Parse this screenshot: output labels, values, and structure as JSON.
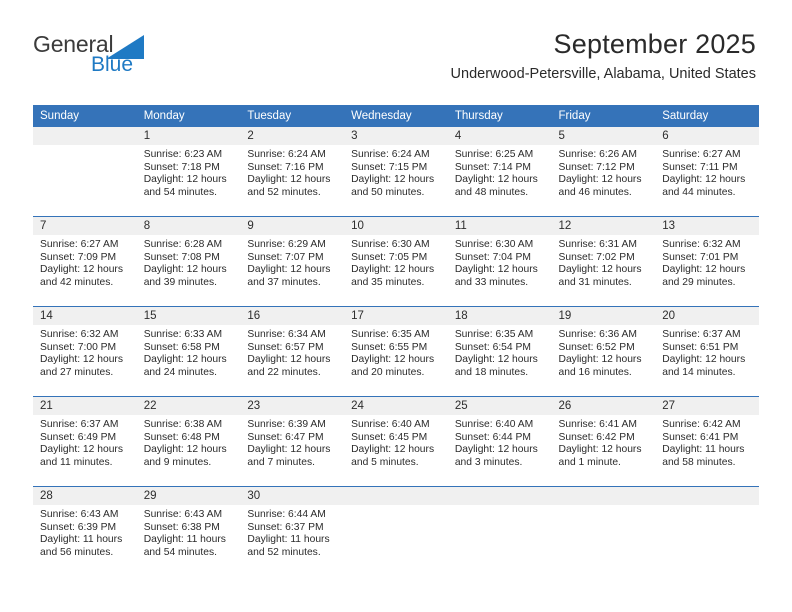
{
  "brand": {
    "name_part1": "General",
    "name_part2": "Blue",
    "accent_color": "#1f7ac4",
    "triangle_icon": "brand-triangle-icon"
  },
  "header": {
    "title": "September 2025",
    "subtitle": "Underwood-Petersville, Alabama, United States"
  },
  "calendar": {
    "header_bg": "#3573b9",
    "daynum_bg": "#f0f0f0",
    "weekday_headers": [
      "Sunday",
      "Monday",
      "Tuesday",
      "Wednesday",
      "Thursday",
      "Friday",
      "Saturday"
    ],
    "weeks": [
      [
        {
          "day": "",
          "empty": true,
          "sunrise": "",
          "sunset": "",
          "daylight_line1": "",
          "daylight_line2": ""
        },
        {
          "day": "1",
          "sunrise": "Sunrise: 6:23 AM",
          "sunset": "Sunset: 7:18 PM",
          "daylight_line1": "Daylight: 12 hours",
          "daylight_line2": "and 54 minutes."
        },
        {
          "day": "2",
          "sunrise": "Sunrise: 6:24 AM",
          "sunset": "Sunset: 7:16 PM",
          "daylight_line1": "Daylight: 12 hours",
          "daylight_line2": "and 52 minutes."
        },
        {
          "day": "3",
          "sunrise": "Sunrise: 6:24 AM",
          "sunset": "Sunset: 7:15 PM",
          "daylight_line1": "Daylight: 12 hours",
          "daylight_line2": "and 50 minutes."
        },
        {
          "day": "4",
          "sunrise": "Sunrise: 6:25 AM",
          "sunset": "Sunset: 7:14 PM",
          "daylight_line1": "Daylight: 12 hours",
          "daylight_line2": "and 48 minutes."
        },
        {
          "day": "5",
          "sunrise": "Sunrise: 6:26 AM",
          "sunset": "Sunset: 7:12 PM",
          "daylight_line1": "Daylight: 12 hours",
          "daylight_line2": "and 46 minutes."
        },
        {
          "day": "6",
          "sunrise": "Sunrise: 6:27 AM",
          "sunset": "Sunset: 7:11 PM",
          "daylight_line1": "Daylight: 12 hours",
          "daylight_line2": "and 44 minutes."
        }
      ],
      [
        {
          "day": "7",
          "sunrise": "Sunrise: 6:27 AM",
          "sunset": "Sunset: 7:09 PM",
          "daylight_line1": "Daylight: 12 hours",
          "daylight_line2": "and 42 minutes."
        },
        {
          "day": "8",
          "sunrise": "Sunrise: 6:28 AM",
          "sunset": "Sunset: 7:08 PM",
          "daylight_line1": "Daylight: 12 hours",
          "daylight_line2": "and 39 minutes."
        },
        {
          "day": "9",
          "sunrise": "Sunrise: 6:29 AM",
          "sunset": "Sunset: 7:07 PM",
          "daylight_line1": "Daylight: 12 hours",
          "daylight_line2": "and 37 minutes."
        },
        {
          "day": "10",
          "sunrise": "Sunrise: 6:30 AM",
          "sunset": "Sunset: 7:05 PM",
          "daylight_line1": "Daylight: 12 hours",
          "daylight_line2": "and 35 minutes."
        },
        {
          "day": "11",
          "sunrise": "Sunrise: 6:30 AM",
          "sunset": "Sunset: 7:04 PM",
          "daylight_line1": "Daylight: 12 hours",
          "daylight_line2": "and 33 minutes."
        },
        {
          "day": "12",
          "sunrise": "Sunrise: 6:31 AM",
          "sunset": "Sunset: 7:02 PM",
          "daylight_line1": "Daylight: 12 hours",
          "daylight_line2": "and 31 minutes."
        },
        {
          "day": "13",
          "sunrise": "Sunrise: 6:32 AM",
          "sunset": "Sunset: 7:01 PM",
          "daylight_line1": "Daylight: 12 hours",
          "daylight_line2": "and 29 minutes."
        }
      ],
      [
        {
          "day": "14",
          "sunrise": "Sunrise: 6:32 AM",
          "sunset": "Sunset: 7:00 PM",
          "daylight_line1": "Daylight: 12 hours",
          "daylight_line2": "and 27 minutes."
        },
        {
          "day": "15",
          "sunrise": "Sunrise: 6:33 AM",
          "sunset": "Sunset: 6:58 PM",
          "daylight_line1": "Daylight: 12 hours",
          "daylight_line2": "and 24 minutes."
        },
        {
          "day": "16",
          "sunrise": "Sunrise: 6:34 AM",
          "sunset": "Sunset: 6:57 PM",
          "daylight_line1": "Daylight: 12 hours",
          "daylight_line2": "and 22 minutes."
        },
        {
          "day": "17",
          "sunrise": "Sunrise: 6:35 AM",
          "sunset": "Sunset: 6:55 PM",
          "daylight_line1": "Daylight: 12 hours",
          "daylight_line2": "and 20 minutes."
        },
        {
          "day": "18",
          "sunrise": "Sunrise: 6:35 AM",
          "sunset": "Sunset: 6:54 PM",
          "daylight_line1": "Daylight: 12 hours",
          "daylight_line2": "and 18 minutes."
        },
        {
          "day": "19",
          "sunrise": "Sunrise: 6:36 AM",
          "sunset": "Sunset: 6:52 PM",
          "daylight_line1": "Daylight: 12 hours",
          "daylight_line2": "and 16 minutes."
        },
        {
          "day": "20",
          "sunrise": "Sunrise: 6:37 AM",
          "sunset": "Sunset: 6:51 PM",
          "daylight_line1": "Daylight: 12 hours",
          "daylight_line2": "and 14 minutes."
        }
      ],
      [
        {
          "day": "21",
          "sunrise": "Sunrise: 6:37 AM",
          "sunset": "Sunset: 6:49 PM",
          "daylight_line1": "Daylight: 12 hours",
          "daylight_line2": "and 11 minutes."
        },
        {
          "day": "22",
          "sunrise": "Sunrise: 6:38 AM",
          "sunset": "Sunset: 6:48 PM",
          "daylight_line1": "Daylight: 12 hours",
          "daylight_line2": "and 9 minutes."
        },
        {
          "day": "23",
          "sunrise": "Sunrise: 6:39 AM",
          "sunset": "Sunset: 6:47 PM",
          "daylight_line1": "Daylight: 12 hours",
          "daylight_line2": "and 7 minutes."
        },
        {
          "day": "24",
          "sunrise": "Sunrise: 6:40 AM",
          "sunset": "Sunset: 6:45 PM",
          "daylight_line1": "Daylight: 12 hours",
          "daylight_line2": "and 5 minutes."
        },
        {
          "day": "25",
          "sunrise": "Sunrise: 6:40 AM",
          "sunset": "Sunset: 6:44 PM",
          "daylight_line1": "Daylight: 12 hours",
          "daylight_line2": "and 3 minutes."
        },
        {
          "day": "26",
          "sunrise": "Sunrise: 6:41 AM",
          "sunset": "Sunset: 6:42 PM",
          "daylight_line1": "Daylight: 12 hours",
          "daylight_line2": "and 1 minute."
        },
        {
          "day": "27",
          "sunrise": "Sunrise: 6:42 AM",
          "sunset": "Sunset: 6:41 PM",
          "daylight_line1": "Daylight: 11 hours",
          "daylight_line2": "and 58 minutes."
        }
      ],
      [
        {
          "day": "28",
          "sunrise": "Sunrise: 6:43 AM",
          "sunset": "Sunset: 6:39 PM",
          "daylight_line1": "Daylight: 11 hours",
          "daylight_line2": "and 56 minutes."
        },
        {
          "day": "29",
          "sunrise": "Sunrise: 6:43 AM",
          "sunset": "Sunset: 6:38 PM",
          "daylight_line1": "Daylight: 11 hours",
          "daylight_line2": "and 54 minutes."
        },
        {
          "day": "30",
          "sunrise": "Sunrise: 6:44 AM",
          "sunset": "Sunset: 6:37 PM",
          "daylight_line1": "Daylight: 11 hours",
          "daylight_line2": "and 52 minutes."
        },
        {
          "day": "",
          "empty": true,
          "sunrise": "",
          "sunset": "",
          "daylight_line1": "",
          "daylight_line2": ""
        },
        {
          "day": "",
          "empty": true,
          "sunrise": "",
          "sunset": "",
          "daylight_line1": "",
          "daylight_line2": ""
        },
        {
          "day": "",
          "empty": true,
          "sunrise": "",
          "sunset": "",
          "daylight_line1": "",
          "daylight_line2": ""
        },
        {
          "day": "",
          "empty": true,
          "sunrise": "",
          "sunset": "",
          "daylight_line1": "",
          "daylight_line2": ""
        }
      ]
    ]
  }
}
